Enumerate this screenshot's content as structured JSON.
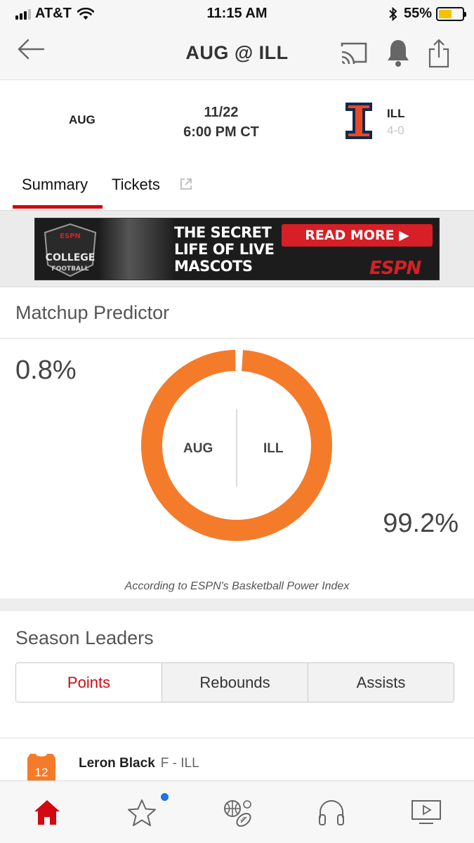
{
  "status_bar": {
    "carrier": "AT&T",
    "time": "11:15 AM",
    "battery": "55%",
    "battery_level": 0.55
  },
  "nav": {
    "title": "AUG @ ILL"
  },
  "game": {
    "away_team": "AUG",
    "home_team": "ILL",
    "home_record": "4-0",
    "date": "11/22",
    "time": "6:00 PM CT",
    "home_color": "#e84a27",
    "home_accent": "#13294b"
  },
  "tabs": [
    {
      "label": "Summary",
      "active": true
    },
    {
      "label": "Tickets",
      "active": false
    }
  ],
  "ad": {
    "badge_top": "ESPN",
    "badge_main": "COLLEGE",
    "badge_sub": "FOOTBALL",
    "headline": "THE SECRET\nLIFE OF LIVE\nMASCOTS",
    "cta": "READ MORE ▶",
    "brand": "ESPN"
  },
  "predictor": {
    "title": "Matchup Predictor",
    "away_label": "AUG",
    "home_label": "ILL",
    "away_pct": "0.8%",
    "home_pct": "99.2%",
    "away_value": 0.8,
    "home_value": 99.2,
    "attribution": "According to ESPN's Basketball Power Index",
    "home_color": "#f47b2a",
    "away_color": "#ffffff"
  },
  "leaders": {
    "title": "Season Leaders",
    "segments": [
      "Points",
      "Rebounds",
      "Assists"
    ],
    "selected": "Points",
    "player": {
      "name": "Leron Black",
      "position": "F - ILL",
      "number": "12"
    }
  },
  "tab_bar": {
    "items": [
      "home-icon",
      "favorites-icon",
      "sports-icon",
      "audio-icon",
      "watch-icon"
    ],
    "active_color": "#d10a11",
    "badge_color": "#1a73e8"
  }
}
